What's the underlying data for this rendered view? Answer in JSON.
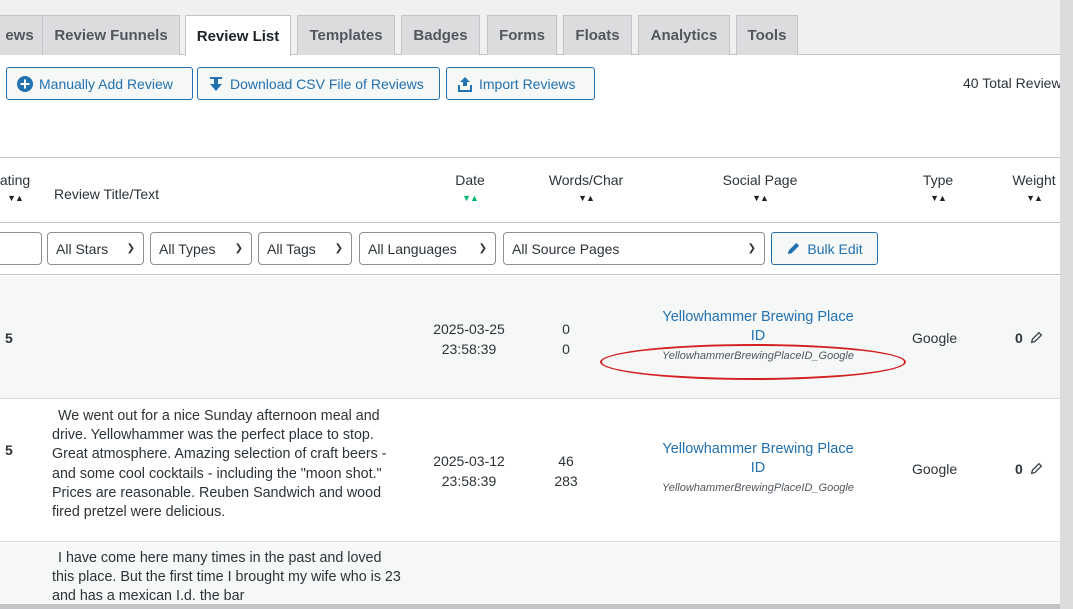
{
  "tabs": [
    {
      "label": "ews",
      "active": false
    },
    {
      "label": "Review Funnels",
      "active": false
    },
    {
      "label": "Review List",
      "active": true
    },
    {
      "label": "Templates",
      "active": false
    },
    {
      "label": "Badges",
      "active": false
    },
    {
      "label": "Forms",
      "active": false
    },
    {
      "label": "Floats",
      "active": false
    },
    {
      "label": "Analytics",
      "active": false
    },
    {
      "label": "Tools",
      "active": false
    }
  ],
  "actions": {
    "add": "Manually Add Review",
    "download": "Download CSV File of Reviews",
    "import": "Import Reviews",
    "total": "40 Total Review"
  },
  "columns": {
    "rating": "ating",
    "title": "Review Title/Text",
    "date": "Date",
    "words": "Words/Char",
    "social": "Social Page",
    "type": "Type",
    "weight": "Weight"
  },
  "filters": {
    "stars": "All Stars",
    "types": "All Types",
    "tags": "All Tags",
    "languages": "All Languages",
    "source": "All Source Pages",
    "bulk": "Bulk Edit"
  },
  "rows": [
    {
      "rating": "5",
      "text": "",
      "date": "2025-03-25",
      "time": "23:58:39",
      "words": "0",
      "chars": "0",
      "social_line1": "Yellowhammer Brewing Place",
      "social_line2": "ID",
      "social_sub": "YellowhammerBrewingPlaceID_Google",
      "type": "Google",
      "weight": "0"
    },
    {
      "rating": "5",
      "text": "We went out for a nice Sunday afternoon meal and drive. Yellowhammer was the perfect place to stop. Great atmosphere. Amazing selection of craft beers - and some cool cocktails - including the \"moon shot.\" Prices are reasonable. Reuben Sandwich and wood fired pretzel were delicious.",
      "date": "2025-03-12",
      "time": "23:58:39",
      "words": "46",
      "chars": "283",
      "social_line1": "Yellowhammer Brewing Place",
      "social_line2": "ID",
      "social_sub": "YellowhammerBrewingPlaceID_Google",
      "type": "Google",
      "weight": "0"
    },
    {
      "rating": "",
      "text": "I have come here many times in the past and loved this place. But the first time I brought my wife who is 23 and has a mexican I.d. the bar",
      "date": "",
      "time": "",
      "words": "",
      "chars": "",
      "social_line1": "",
      "social_line2": "",
      "social_sub": "",
      "type": "",
      "weight": ""
    }
  ],
  "colors": {
    "accent": "#2271b1",
    "sort_active": "#00b86b",
    "annotation": "#d32020"
  }
}
